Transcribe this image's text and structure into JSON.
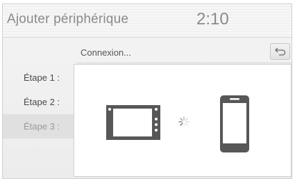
{
  "header": {
    "title": "Ajouter périphérique",
    "clock": "2:10"
  },
  "subbar": {
    "status": "Connexion...",
    "back_icon": "back-arrow-icon"
  },
  "steps": [
    {
      "label": "Étape 1 :",
      "active": false
    },
    {
      "label": "Étape 2 :",
      "active": false
    },
    {
      "label": "Étape 3 :",
      "active": true
    }
  ],
  "panel": {
    "left_icon": "car-head-unit-icon",
    "middle_icon": "loading-spinner-icon",
    "right_icon": "smartphone-icon"
  },
  "colors": {
    "icon_dark": "#555555",
    "text_muted": "#8a8a8a"
  }
}
